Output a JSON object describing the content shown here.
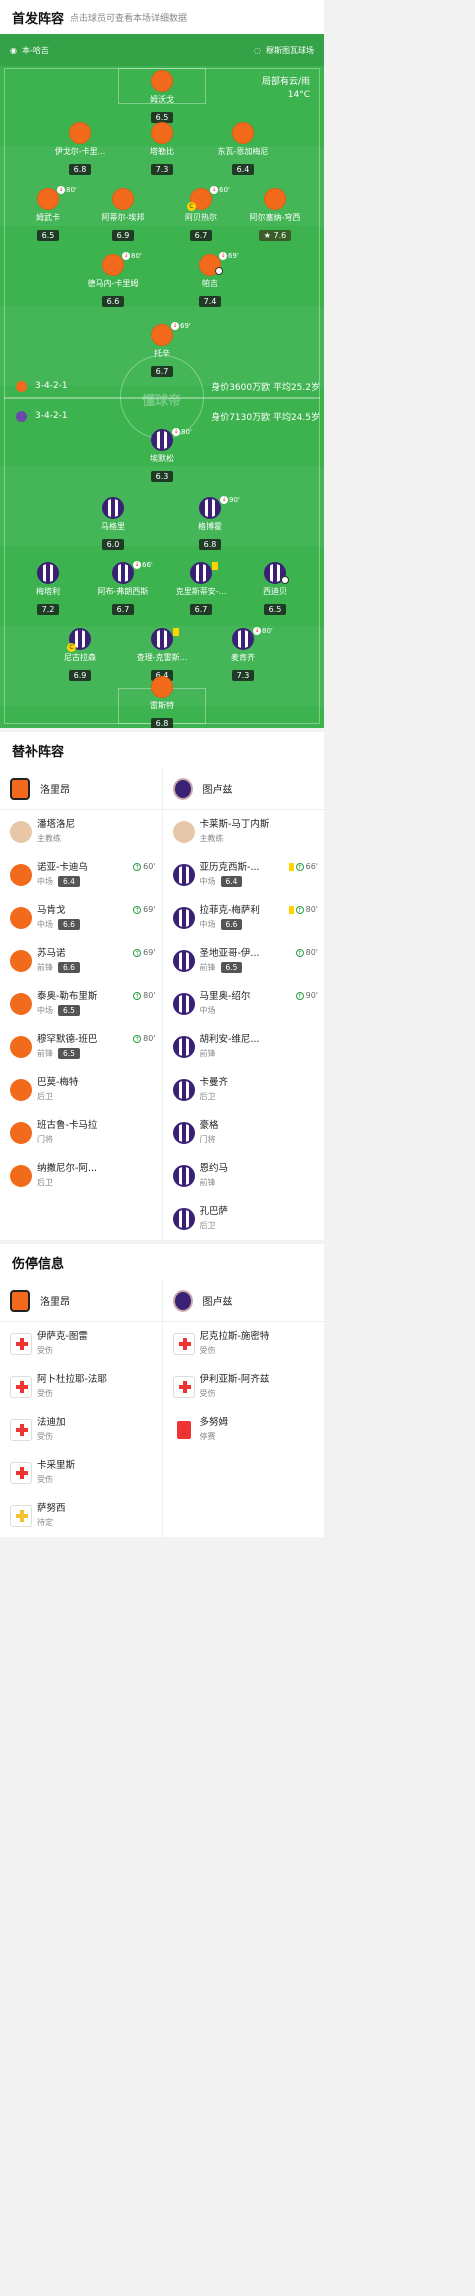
{
  "lineup": {
    "title": "首发阵容",
    "subtitle": "点击球员可查看本场详细数据",
    "home_formation_label": "本-哈吉",
    "away_formation_label": "穆斯图瓦球场",
    "weather_line1": "局部有云/雨",
    "weather_line2": "14°C",
    "watermark": "懂球帝",
    "away_row": {
      "formation": "3-4-2-1",
      "info": "身价3600万欧 平均25.2岁"
    },
    "home_row": {
      "formation": "3-4-2-1",
      "info": "身价7130万欧 平均24.5岁"
    },
    "orange_players": [
      {
        "name": "姆沃戈",
        "rating": "6.5"
      },
      {
        "name": "伊戈尔-卡里...",
        "rating": "6.8"
      },
      {
        "name": "塔勒比",
        "rating": "7.3"
      },
      {
        "name": "东瓦-恩加梅尼",
        "rating": "6.4"
      },
      {
        "name": "姆武卡",
        "rating": "6.5",
        "sub": "80'"
      },
      {
        "name": "阿蒂尔-埃邦",
        "rating": "6.9"
      },
      {
        "name": "阿贝热尔",
        "rating": "6.7",
        "sub": "60'"
      },
      {
        "name": "阿尔塞纳-穹西",
        "rating": "7.6"
      },
      {
        "name": "德马内-卡里姆",
        "rating": "6.6",
        "sub": "80'"
      },
      {
        "name": "帕吉",
        "rating": "7.4",
        "sub": "69'"
      },
      {
        "name": "托辛",
        "rating": "6.7",
        "sub": "69'"
      }
    ],
    "purple_players": [
      {
        "name": "埃默松",
        "rating": "6.3",
        "sub": "80'"
      },
      {
        "name": "马格里",
        "rating": "6.0"
      },
      {
        "name": "格博霍",
        "rating": "6.8",
        "sub": "90'"
      },
      {
        "name": "梅塔利",
        "rating": "7.2"
      },
      {
        "name": "阿布-弗朗西斯",
        "rating": "6.7",
        "sub": "66'"
      },
      {
        "name": "克里斯蒂安-...",
        "rating": "6.7"
      },
      {
        "name": "西迪贝",
        "rating": "6.5"
      },
      {
        "name": "尼古拉森",
        "rating": "6.9"
      },
      {
        "name": "查理-克雷斯...",
        "rating": "6.4"
      },
      {
        "name": "麦肯齐",
        "rating": "7.3",
        "sub": "80'"
      },
      {
        "name": "雷斯特",
        "rating": "6.8"
      }
    ]
  },
  "subs": {
    "title": "替补阵容",
    "home_team": "洛里昂",
    "away_team": "图卢兹",
    "home_coach": {
      "name": "潘塔洛尼",
      "role": "主教练"
    },
    "away_coach": {
      "name": "卡莱斯-马丁内斯",
      "role": "主教练"
    },
    "home": [
      {
        "name": "诺亚-卡迪乌",
        "pos": "中场",
        "rating": "6.4",
        "min": "60'"
      },
      {
        "name": "马肯戈",
        "pos": "中场",
        "rating": "6.6",
        "min": "69'"
      },
      {
        "name": "苏马诺",
        "pos": "前锋",
        "rating": "6.6",
        "min": "69'"
      },
      {
        "name": "泰奥-勒布里斯",
        "pos": "中场",
        "rating": "6.5",
        "min": "80'"
      },
      {
        "name": "穆罕默德-班巴",
        "pos": "前锋",
        "rating": "6.5",
        "min": "80'"
      },
      {
        "name": "巴莫-梅特",
        "pos": "后卫"
      },
      {
        "name": "班古鲁-卡马拉",
        "pos": "门将"
      },
      {
        "name": "纳撒尼尔-阿...",
        "pos": "后卫"
      }
    ],
    "away": [
      {
        "name": "亚历克西斯-...",
        "pos": "中场",
        "rating": "6.4",
        "min": "66'",
        "yellow": true
      },
      {
        "name": "拉菲克-梅萨利",
        "pos": "中场",
        "rating": "6.6",
        "min": "80'",
        "yellow": true
      },
      {
        "name": "圣地亚哥-伊...",
        "pos": "前锋",
        "rating": "6.5",
        "min": "80'"
      },
      {
        "name": "马里奥-绍尔",
        "pos": "中场",
        "min": "90'"
      },
      {
        "name": "胡利安-维尼...",
        "pos": "前锋"
      },
      {
        "name": "卡曼齐",
        "pos": "后卫"
      },
      {
        "name": "豪格",
        "pos": "门将"
      },
      {
        "name": "恩约马",
        "pos": "前锋"
      },
      {
        "name": "孔巴萨",
        "pos": "后卫"
      }
    ]
  },
  "injury": {
    "title": "伤停信息",
    "home_team": "洛里昂",
    "away_team": "图卢兹",
    "home": [
      {
        "name": "伊萨克-图雷",
        "status": "受伤"
      },
      {
        "name": "阿卜杜拉耶-法耶",
        "status": "受伤"
      },
      {
        "name": "法迪加",
        "status": "受伤"
      },
      {
        "name": "卡采里斯",
        "status": "受伤"
      },
      {
        "name": "萨努西",
        "status": "待定"
      }
    ],
    "away": [
      {
        "name": "尼克拉斯-施密特",
        "status": "受伤"
      },
      {
        "name": "伊利亚斯-阿齐兹",
        "status": "受伤"
      },
      {
        "name": "多努姆",
        "status": "停赛"
      }
    ]
  }
}
